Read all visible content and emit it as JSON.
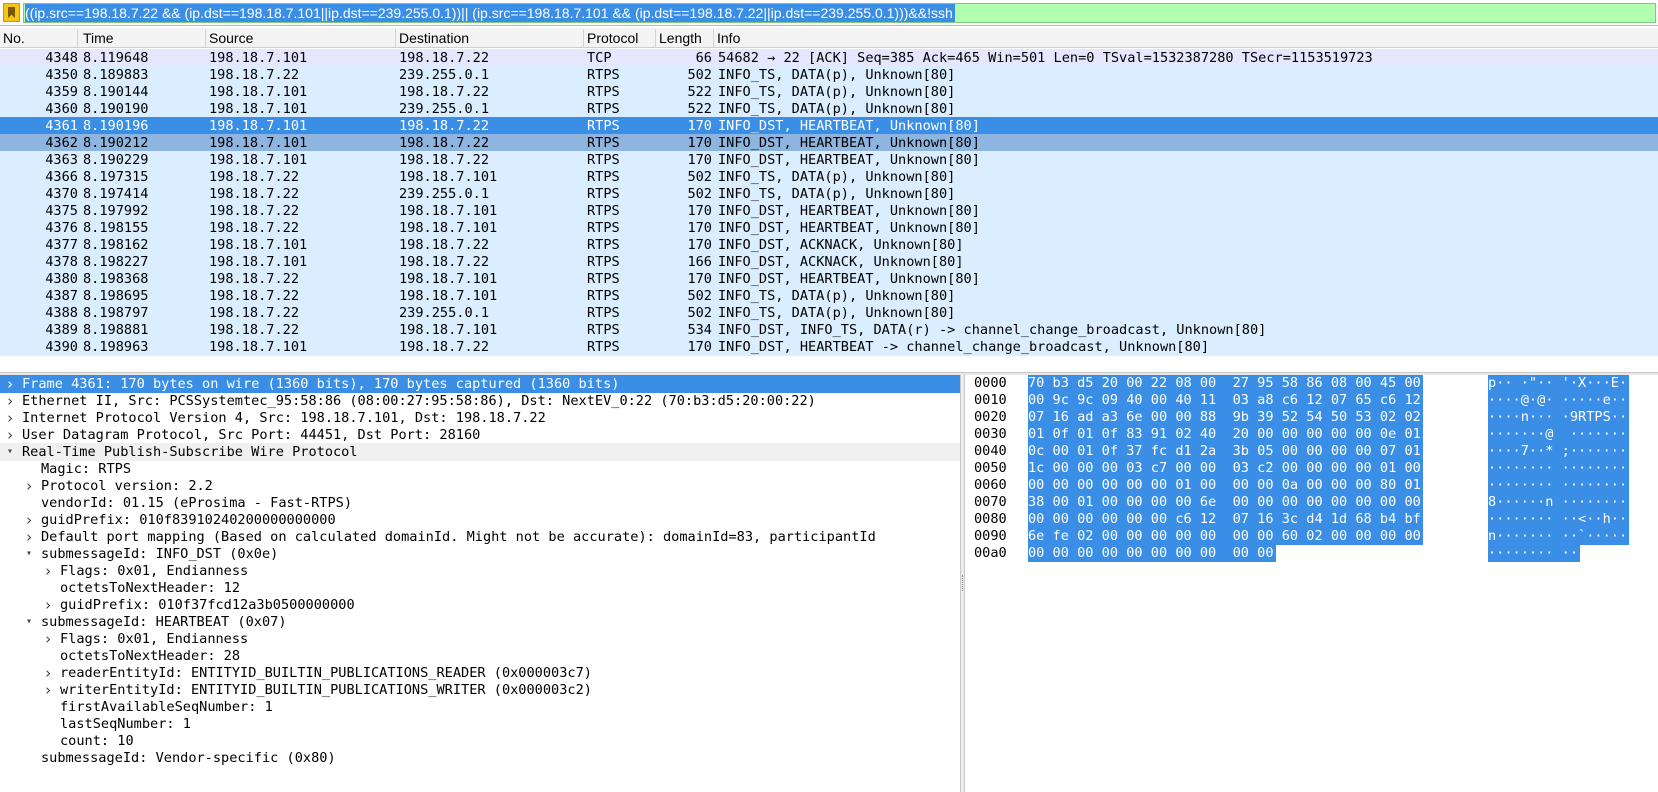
{
  "filter": {
    "text": "((ip.src==198.18.7.22 && (ip.dst==198.18.7.101||ip.dst==239.255.0.1))|| (ip.src==198.18.7.101 && (ip.dst==198.18.7.22||ip.dst==239.255.0.1)))&&!ssh"
  },
  "packet_list": {
    "columns": [
      "No.",
      "Time",
      "Source",
      "Destination",
      "Protocol",
      "Length",
      "Info"
    ],
    "rows": [
      {
        "no": "4348",
        "time": "8.119648",
        "src": "198.18.7.101",
        "dst": "198.18.7.22",
        "proto": "TCP",
        "len": "66",
        "info": "54682 → 22 [ACK] Seq=385 Ack=465 Win=501 Len=0 TSval=1532387280 TSecr=1153519723",
        "state": "tcp"
      },
      {
        "no": "4350",
        "time": "8.189883",
        "src": "198.18.7.22",
        "dst": "239.255.0.1",
        "proto": "RTPS",
        "len": "502",
        "info": "INFO_TS, DATA(p), Unknown[80]",
        "state": "rtps"
      },
      {
        "no": "4359",
        "time": "8.190144",
        "src": "198.18.7.101",
        "dst": "198.18.7.22",
        "proto": "RTPS",
        "len": "522",
        "info": "INFO_TS, DATA(p), Unknown[80]",
        "state": "rtps"
      },
      {
        "no": "4360",
        "time": "8.190190",
        "src": "198.18.7.101",
        "dst": "239.255.0.1",
        "proto": "RTPS",
        "len": "522",
        "info": "INFO_TS, DATA(p), Unknown[80]",
        "state": "rtps"
      },
      {
        "no": "4361",
        "time": "8.190196",
        "src": "198.18.7.101",
        "dst": "198.18.7.22",
        "proto": "RTPS",
        "len": "170",
        "info": "INFO_DST, HEARTBEAT, Unknown[80]",
        "state": "selected"
      },
      {
        "no": "4362",
        "time": "8.190212",
        "src": "198.18.7.101",
        "dst": "198.18.7.22",
        "proto": "RTPS",
        "len": "170",
        "info": "INFO_DST, HEARTBEAT, Unknown[80]",
        "state": "related"
      },
      {
        "no": "4363",
        "time": "8.190229",
        "src": "198.18.7.101",
        "dst": "198.18.7.22",
        "proto": "RTPS",
        "len": "170",
        "info": "INFO_DST, HEARTBEAT, Unknown[80]",
        "state": "rtps"
      },
      {
        "no": "4366",
        "time": "8.197315",
        "src": "198.18.7.22",
        "dst": "198.18.7.101",
        "proto": "RTPS",
        "len": "502",
        "info": "INFO_TS, DATA(p), Unknown[80]",
        "state": "rtps"
      },
      {
        "no": "4370",
        "time": "8.197414",
        "src": "198.18.7.22",
        "dst": "239.255.0.1",
        "proto": "RTPS",
        "len": "502",
        "info": "INFO_TS, DATA(p), Unknown[80]",
        "state": "rtps"
      },
      {
        "no": "4375",
        "time": "8.197992",
        "src": "198.18.7.22",
        "dst": "198.18.7.101",
        "proto": "RTPS",
        "len": "170",
        "info": "INFO_DST, HEARTBEAT, Unknown[80]",
        "state": "rtps"
      },
      {
        "no": "4376",
        "time": "8.198155",
        "src": "198.18.7.22",
        "dst": "198.18.7.101",
        "proto": "RTPS",
        "len": "170",
        "info": "INFO_DST, HEARTBEAT, Unknown[80]",
        "state": "rtps"
      },
      {
        "no": "4377",
        "time": "8.198162",
        "src": "198.18.7.101",
        "dst": "198.18.7.22",
        "proto": "RTPS",
        "len": "170",
        "info": "INFO_DST, ACKNACK, Unknown[80]",
        "state": "rtps"
      },
      {
        "no": "4378",
        "time": "8.198227",
        "src": "198.18.7.101",
        "dst": "198.18.7.22",
        "proto": "RTPS",
        "len": "166",
        "info": "INFO_DST, ACKNACK, Unknown[80]",
        "state": "rtps"
      },
      {
        "no": "4380",
        "time": "8.198368",
        "src": "198.18.7.22",
        "dst": "198.18.7.101",
        "proto": "RTPS",
        "len": "170",
        "info": "INFO_DST, HEARTBEAT, Unknown[80]",
        "state": "rtps"
      },
      {
        "no": "4387",
        "time": "8.198695",
        "src": "198.18.7.22",
        "dst": "198.18.7.101",
        "proto": "RTPS",
        "len": "502",
        "info": "INFO_TS, DATA(p), Unknown[80]",
        "state": "rtps"
      },
      {
        "no": "4388",
        "time": "8.198797",
        "src": "198.18.7.22",
        "dst": "239.255.0.1",
        "proto": "RTPS",
        "len": "502",
        "info": "INFO_TS, DATA(p), Unknown[80]",
        "state": "rtps"
      },
      {
        "no": "4389",
        "time": "8.198881",
        "src": "198.18.7.22",
        "dst": "198.18.7.101",
        "proto": "RTPS",
        "len": "534",
        "info": "INFO_DST, INFO_TS, DATA(r) -> channel_change_broadcast, Unknown[80]",
        "state": "rtps"
      },
      {
        "no": "4390",
        "time": "8.198963",
        "src": "198.18.7.101",
        "dst": "198.18.7.22",
        "proto": "RTPS",
        "len": "170",
        "info": "INFO_DST, HEARTBEAT -> channel_change_broadcast, Unknown[80]",
        "state": "rtps"
      }
    ]
  },
  "details": {
    "rows": [
      {
        "text": "Frame 4361: 170 bytes on wire (1360 bits), 170 bytes captured (1360 bits)",
        "indent": 0,
        "arrow": "right",
        "style": "sel"
      },
      {
        "text": "Ethernet II, Src: PCSSystemtec_95:58:86 (08:00:27:95:58:86), Dst: NextEV_0:22 (70:b3:d5:20:00:22)",
        "indent": 0,
        "arrow": "right",
        "style": ""
      },
      {
        "text": "Internet Protocol Version 4, Src: 198.18.7.101, Dst: 198.18.7.22",
        "indent": 0,
        "arrow": "right",
        "style": ""
      },
      {
        "text": "User Datagram Protocol, Src Port: 44451, Dst Port: 28160",
        "indent": 0,
        "arrow": "right",
        "style": ""
      },
      {
        "text": "Real-Time Publish-Subscribe Wire Protocol",
        "indent": 0,
        "arrow": "down",
        "style": "grp"
      },
      {
        "text": "Magic: RTPS",
        "indent": 1,
        "arrow": "",
        "style": ""
      },
      {
        "text": "Protocol version: 2.2",
        "indent": 1,
        "arrow": "right",
        "style": ""
      },
      {
        "text": "vendorId: 01.15 (eProsima - Fast-RTPS)",
        "indent": 1,
        "arrow": "",
        "style": ""
      },
      {
        "text": "guidPrefix: 010f83910240200000000000",
        "indent": 1,
        "arrow": "right",
        "style": ""
      },
      {
        "text": "Default port mapping (Based on calculated domainId. Might not be accurate): domainId=83, participantId",
        "indent": 1,
        "arrow": "right",
        "style": ""
      },
      {
        "text": "submessageId: INFO_DST (0x0e)",
        "indent": 1,
        "arrow": "down",
        "style": ""
      },
      {
        "text": "Flags: 0x01, Endianness",
        "indent": 2,
        "arrow": "right",
        "style": ""
      },
      {
        "text": "octetsToNextHeader: 12",
        "indent": 2,
        "arrow": "",
        "style": ""
      },
      {
        "text": "guidPrefix: 010f37fcd12a3b0500000000",
        "indent": 2,
        "arrow": "right",
        "style": ""
      },
      {
        "text": "submessageId: HEARTBEAT (0x07)",
        "indent": 1,
        "arrow": "down",
        "style": ""
      },
      {
        "text": "Flags: 0x01, Endianness",
        "indent": 2,
        "arrow": "right",
        "style": ""
      },
      {
        "text": "octetsToNextHeader: 28",
        "indent": 2,
        "arrow": "",
        "style": ""
      },
      {
        "text": "readerEntityId: ENTITYID_BUILTIN_PUBLICATIONS_READER (0x000003c7)",
        "indent": 2,
        "arrow": "right",
        "style": ""
      },
      {
        "text": "writerEntityId: ENTITYID_BUILTIN_PUBLICATIONS_WRITER (0x000003c2)",
        "indent": 2,
        "arrow": "right",
        "style": ""
      },
      {
        "text": "firstAvailableSeqNumber: 1",
        "indent": 2,
        "arrow": "",
        "style": ""
      },
      {
        "text": "lastSeqNumber: 1",
        "indent": 2,
        "arrow": "",
        "style": ""
      },
      {
        "text": "count: 10",
        "indent": 2,
        "arrow": "",
        "style": ""
      },
      {
        "text": "submessageId: Vendor-specific (0x80)",
        "indent": 1,
        "arrow": "",
        "style": ""
      }
    ]
  },
  "bytes": {
    "rows": [
      {
        "off": "0000",
        "hex": "70 b3 d5 20 00 22 08 00  27 95 58 86 08 00 45 00",
        "ascii": "p·· ·\"·· '·X···E·"
      },
      {
        "off": "0010",
        "hex": "00 9c 9c 09 40 00 40 11  03 a8 c6 12 07 65 c6 12",
        "ascii": "····@·@· ·····e··"
      },
      {
        "off": "0020",
        "hex": "07 16 ad a3 6e 00 00 88  9b 39 52 54 50 53 02 02",
        "ascii": "····n··· ·9RTPS··"
      },
      {
        "off": "0030",
        "hex": "01 0f 01 0f 83 91 02 40  20 00 00 00 00 00 0e 01",
        "ascii": "·······@  ·······"
      },
      {
        "off": "0040",
        "hex": "0c 00 01 0f 37 fc d1 2a  3b 05 00 00 00 00 07 01",
        "ascii": "····7··* ;·······"
      },
      {
        "off": "0050",
        "hex": "1c 00 00 00 03 c7 00 00  03 c2 00 00 00 00 01 00",
        "ascii": "········ ········"
      },
      {
        "off": "0060",
        "hex": "00 00 00 00 00 00 01 00  00 00 0a 00 00 00 80 01",
        "ascii": "········ ········"
      },
      {
        "off": "0070",
        "hex": "38 00 01 00 00 00 00 6e  00 00 00 00 00 00 00 00",
        "ascii": "8······n ········"
      },
      {
        "off": "0080",
        "hex": "00 00 00 00 00 00 c6 12  07 16 3c d4 1d 68 b4 bf",
        "ascii": "········ ··<··h··"
      },
      {
        "off": "0090",
        "hex": "6e fe 02 00 00 00 00 00  00 00 60 02 00 00 00 00",
        "ascii": "n······· ··`·····"
      },
      {
        "off": "00a0",
        "hex": "00 00 00 00 00 00 00 00  00 00",
        "ascii": "········ ··"
      }
    ]
  },
  "colors": {
    "selection": "#3a8ee6",
    "related": "#8eb5e0",
    "rtps_row": "#daeeff",
    "tcp_row": "#e7e6ff",
    "filter_valid": "#afffaf"
  }
}
